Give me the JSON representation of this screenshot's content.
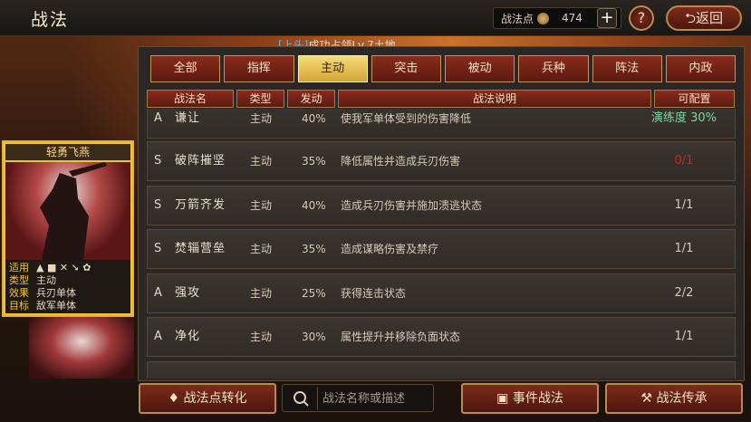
{
  "header": {
    "title": "战法",
    "points_label": "战法点",
    "points_value": "474",
    "plus": "+",
    "help": "?",
    "back_label": "返回"
  },
  "note": {
    "tag": "[上头]",
    "text": "成功占领Lv.7土地"
  },
  "tabs": [
    "全部",
    "指挥",
    "主动",
    "突击",
    "被动",
    "兵种",
    "阵法",
    "内政"
  ],
  "active_tab": "主动",
  "columns": [
    "战法名",
    "类型",
    "发动",
    "战法说明",
    "可配置"
  ],
  "rows": [
    {
      "grade": "A",
      "name": "谦让",
      "type": "主动",
      "rate": "40%",
      "desc": "使我军单体受到的伤害降低",
      "conf": "演练度 30%"
    },
    {
      "grade": "S",
      "name": "破阵摧坚",
      "type": "主动",
      "rate": "35%",
      "desc": "降低属性并造成兵刃伤害",
      "conf": "0/1"
    },
    {
      "grade": "S",
      "name": "万箭齐发",
      "type": "主动",
      "rate": "40%",
      "desc": "造成兵刃伤害并施加溃逃状态",
      "conf": "1/1"
    },
    {
      "grade": "S",
      "name": "焚辎营垒",
      "type": "主动",
      "rate": "35%",
      "desc": "造成谋略伤害及禁疗",
      "conf": "1/1"
    },
    {
      "grade": "A",
      "name": "强攻",
      "type": "主动",
      "rate": "25%",
      "desc": "获得连击状态",
      "conf": "2/2"
    },
    {
      "grade": "A",
      "name": "净化",
      "type": "主动",
      "rate": "30%",
      "desc": "属性提升并移除负面状态",
      "conf": "1/1"
    }
  ],
  "card": {
    "title": "轻勇飞燕",
    "apply_label": "适用",
    "type_label": "类型",
    "type_value": "主动",
    "effect_label": "效果",
    "effect_value": "兵刃单体",
    "target_label": "目标",
    "target_value": "敌军单体"
  },
  "bottom": {
    "convert": "战法点转化",
    "search_placeholder": "战法名称或描述",
    "event": "事件战法",
    "inherit": "战法传承"
  },
  "colors": {
    "accent_red": "#7d2b1a",
    "gold": "#f0c23a",
    "insufficient": "#c02a1e",
    "practice": "#7fd4a7"
  }
}
